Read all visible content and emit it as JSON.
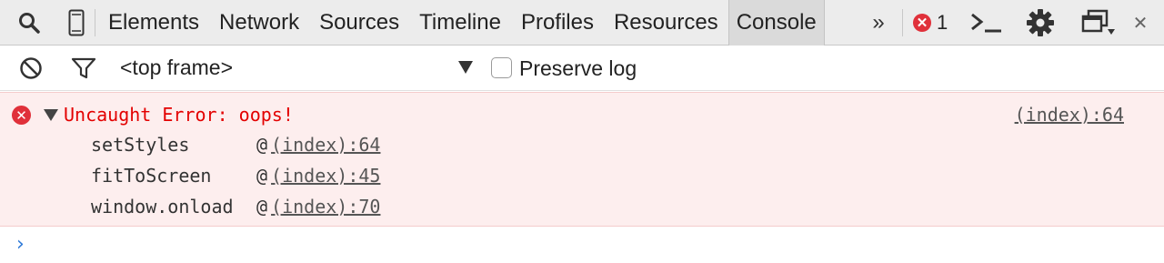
{
  "toolbar": {
    "tabs": [
      "Elements",
      "Network",
      "Sources",
      "Timeline",
      "Profiles",
      "Resources",
      "Console"
    ],
    "active_tab": "Console",
    "more_tabs_glyph": "»",
    "error_count": "1",
    "icons": [
      "search-icon",
      "device-mode-icon",
      "more-tabs-icon",
      "console-drawer-icon",
      "gear-icon",
      "dock-side-icon",
      "close-icon"
    ]
  },
  "filterbar": {
    "icons": [
      "clear-console-icon",
      "filter-icon"
    ],
    "frame_select": "<top frame>",
    "preserve_log_label": "Preserve log",
    "preserve_log_checked": false
  },
  "message": {
    "level": "error",
    "text": "Uncaught Error: oops!",
    "source": "(index):64",
    "expanded": true,
    "stack": [
      {
        "function": "setStyles",
        "at": "@",
        "location": "(index):64"
      },
      {
        "function": "fitToScreen",
        "at": "@",
        "location": "(index):45"
      },
      {
        "function": "window.onload",
        "at": "@",
        "location": "(index):70"
      }
    ]
  },
  "prompt": {
    "glyph": "›"
  },
  "colors": {
    "error_red": "#e30000",
    "error_background": "#fdeeee",
    "prompt_blue": "#2f7ad8",
    "toolbar_background": "#ececec"
  }
}
